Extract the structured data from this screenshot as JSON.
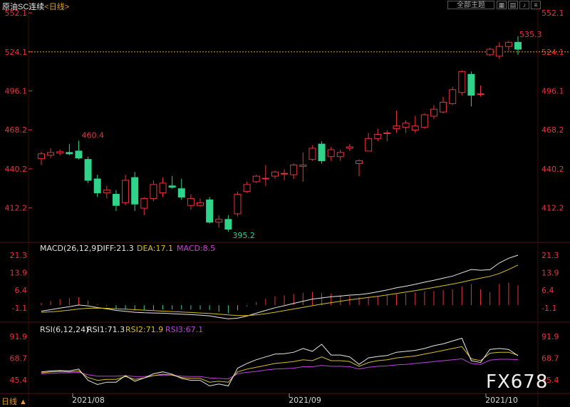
{
  "header": {
    "instrument": "原油SC连续",
    "period_label": "<日线>",
    "main_indicator_button": "全部主题",
    "toolbar_icons": [
      "grid-icon",
      "layout-icon",
      "bell-icon",
      "menu-icon"
    ]
  },
  "price_panel": {
    "ticks": [
      "552.1",
      "524.1",
      "496.1",
      "468.2",
      "440.2",
      "412.2"
    ],
    "high_label": "460.4",
    "low_label": "395.2",
    "last_high_label": "535.3",
    "current_price_line": "524.1"
  },
  "macd_panel": {
    "label": "MACD(26,12,9)",
    "diff_label": "DIFF:21.3",
    "dea_label": "DEA:17.1",
    "macd_label": "MACD:8.5",
    "ticks": [
      "21.3",
      "13.9",
      "6.4",
      "-1.1"
    ]
  },
  "rsi_panel": {
    "label": "RSI(6,12,24)",
    "rsi1_label": "RSI1:71.3",
    "rsi2_label": "RSI2:71.9",
    "rsi3_label": "RSI3:67.1",
    "ticks": [
      "91.9",
      "68.7",
      "45.4"
    ]
  },
  "x_axis": {
    "bottom_left_label": "日线 ▲",
    "month_labels": [
      "2021/08",
      "2021/09",
      "2021/10"
    ]
  },
  "watermark": "FX678",
  "colors": {
    "up": "#e8333a",
    "down": "#2fd38a",
    "diff": "#e6e6e6",
    "dea": "#d8c020",
    "macd_label": "#d040d0",
    "rsi3": "#c040e0",
    "axis_red": "#e8333a"
  },
  "chart_data": [
    {
      "type": "candlestick",
      "title": "原油SC连续 <日线>",
      "ylim": [
        395.2,
        552.1
      ],
      "ohlc": [
        [
          447.5,
          452.5,
          443.0,
          451.0
        ],
        [
          450.0,
          455.0,
          448.0,
          452.0
        ],
        [
          451.5,
          454.0,
          450.0,
          452.5
        ],
        [
          452.0,
          458.0,
          450.0,
          451.0
        ],
        [
          453.0,
          460.4,
          447.0,
          448.0
        ],
        [
          447.0,
          449.0,
          430.0,
          432.0
        ],
        [
          433.0,
          436.0,
          420.0,
          423.0
        ],
        [
          423.0,
          428.0,
          419.0,
          425.0
        ],
        [
          422.0,
          425.0,
          410.0,
          414.0
        ],
        [
          416.0,
          436.0,
          414.0,
          432.0
        ],
        [
          434.0,
          438.0,
          410.0,
          415.0
        ],
        [
          412.0,
          420.0,
          407.0,
          419.0
        ],
        [
          419.0,
          432.0,
          417.0,
          429.0
        ],
        [
          423.0,
          434.0,
          420.0,
          430.0
        ],
        [
          428.0,
          435.0,
          426.0,
          427.0
        ],
        [
          426.0,
          433.0,
          418.0,
          420.0
        ],
        [
          414.0,
          422.0,
          411.0,
          419.0
        ],
        [
          414.0,
          419.0,
          413.0,
          416.0
        ],
        [
          418.0,
          420.0,
          401.0,
          402.0
        ],
        [
          402.0,
          407.0,
          398.0,
          404.0
        ],
        [
          404.0,
          407.0,
          395.2,
          397.0
        ],
        [
          408.0,
          424.0,
          406.0,
          422.0
        ],
        [
          424.0,
          431.0,
          423.0,
          429.0
        ],
        [
          431.0,
          436.0,
          430.0,
          435.0
        ],
        [
          433.0,
          443.0,
          428.0,
          433.5
        ],
        [
          435.0,
          439.0,
          433.0,
          438.0
        ],
        [
          437.0,
          440.0,
          432.0,
          437.0
        ],
        [
          436.0,
          444.0,
          433.0,
          443.0
        ],
        [
          442.0,
          452.0,
          431.0,
          443.0
        ],
        [
          447.0,
          457.0,
          446.0,
          455.0
        ],
        [
          458.0,
          460.0,
          444.0,
          446.0
        ],
        [
          449.0,
          456.0,
          446.0,
          454.0
        ],
        [
          449.0,
          454.0,
          446.0,
          452.0
        ],
        [
          455.0,
          458.0,
          453.0,
          456.0
        ],
        [
          444.0,
          447.0,
          435.0,
          446.0
        ],
        [
          453.0,
          466.0,
          453.0,
          462.0
        ],
        [
          462.0,
          469.0,
          460.0,
          465.0
        ],
        [
          466.0,
          468.0,
          460.0,
          466.0
        ],
        [
          469.0,
          482.0,
          466.0,
          471.0
        ],
        [
          470.0,
          475.0,
          466.0,
          473.0
        ],
        [
          468.0,
          478.0,
          466.0,
          471.0
        ],
        [
          470.0,
          480.0,
          469.0,
          479.0
        ],
        [
          478.0,
          486.0,
          476.0,
          483.0
        ],
        [
          481.0,
          492.0,
          480.0,
          488.0
        ],
        [
          487.0,
          499.0,
          486.0,
          497.0
        ],
        [
          495.0,
          511.0,
          493.0,
          510.0
        ],
        [
          508.0,
          510.0,
          485.0,
          493.0
        ],
        [
          494.0,
          500.0,
          492.0,
          494.0
        ],
        [
          522.0,
          527.0,
          521.0,
          526.0
        ],
        [
          521.0,
          531.0,
          519.0,
          528.0
        ],
        [
          528.0,
          532.0,
          525.0,
          531.0
        ],
        [
          531.0,
          535.3,
          522.0,
          526.0
        ]
      ]
    },
    {
      "type": "line",
      "title": "MACD(26,12,9)",
      "ylim": [
        -6.0,
        21.3
      ],
      "series": [
        {
          "name": "DIFF",
          "values": [
            -2.5,
            -1.9,
            -1.2,
            -0.6,
            0.1,
            -0.3,
            -1.0,
            -1.5,
            -2.2,
            -2.6,
            -3.0,
            -3.2,
            -3.3,
            -3.4,
            -3.6,
            -3.8,
            -4.0,
            -4.2,
            -4.5,
            -5.2,
            -5.8,
            -5.5,
            -4.6,
            -3.4,
            -2.2,
            -1.1,
            -0.2,
            0.8,
            1.7,
            2.6,
            3.1,
            3.6,
            3.9,
            4.3,
            4.5,
            5.0,
            5.7,
            6.5,
            7.4,
            8.1,
            8.9,
            9.8,
            10.6,
            11.5,
            12.4,
            13.8,
            15.2,
            14.9,
            15.1,
            18.0,
            20.0,
            21.3
          ]
        },
        {
          "name": "DEA",
          "values": [
            -3.0,
            -2.8,
            -2.5,
            -2.1,
            -1.6,
            -1.3,
            -1.2,
            -1.3,
            -1.5,
            -1.7,
            -1.9,
            -2.1,
            -2.3,
            -2.5,
            -2.7,
            -2.9,
            -3.1,
            -3.3,
            -3.5,
            -3.8,
            -4.1,
            -4.4,
            -4.4,
            -4.1,
            -3.6,
            -3.0,
            -2.3,
            -1.6,
            -0.9,
            -0.2,
            0.5,
            1.1,
            1.7,
            2.3,
            2.8,
            3.3,
            3.8,
            4.4,
            5.0,
            5.6,
            6.2,
            6.9,
            7.6,
            8.3,
            9.0,
            9.8,
            10.7,
            11.5,
            12.3,
            13.5,
            15.2,
            17.1
          ]
        },
        {
          "name": "MACD",
          "type": "bar",
          "values": [
            1.0,
            1.8,
            2.6,
            3.0,
            3.4,
            2.0,
            0.4,
            -0.4,
            -1.4,
            -1.8,
            -2.2,
            -2.2,
            -2.0,
            -1.8,
            -1.8,
            -1.8,
            -1.8,
            -1.8,
            -2.0,
            -2.8,
            -3.4,
            -2.2,
            -0.4,
            1.4,
            2.8,
            3.8,
            4.2,
            4.8,
            5.2,
            5.6,
            5.2,
            5.0,
            4.4,
            4.0,
            3.4,
            3.4,
            3.8,
            4.2,
            4.8,
            5.0,
            5.4,
            5.8,
            6.0,
            6.4,
            6.8,
            8.0,
            9.0,
            6.8,
            5.6,
            9.0,
            9.6,
            8.5
          ]
        }
      ]
    },
    {
      "type": "line",
      "title": "RSI(6,12,24)",
      "ylim": [
        34.0,
        91.9
      ],
      "series": [
        {
          "name": "RSI1",
          "values": [
            54.0,
            55.0,
            55.5,
            55.0,
            57.0,
            45.0,
            40.5,
            43.0,
            43.0,
            50.0,
            44.0,
            47.5,
            52.0,
            54.0,
            51.5,
            47.0,
            45.0,
            45.0,
            39.0,
            41.0,
            39.0,
            58.0,
            63.0,
            67.0,
            70.0,
            73.0,
            73.5,
            75.0,
            79.0,
            76.0,
            83.5,
            72.0,
            72.0,
            70.0,
            62.0,
            69.0,
            70.5,
            71.5,
            75.0,
            76.0,
            77.0,
            79.0,
            82.0,
            84.0,
            87.0,
            90.0,
            66.0,
            64.0,
            78.0,
            79.0,
            78.0,
            71.3
          ]
        },
        {
          "name": "RSI2",
          "values": [
            53.0,
            54.0,
            54.5,
            54.0,
            55.0,
            48.0,
            45.0,
            46.0,
            46.0,
            49.0,
            46.0,
            47.5,
            50.0,
            51.5,
            50.5,
            48.0,
            47.0,
            47.0,
            43.0,
            44.0,
            43.0,
            54.0,
            57.0,
            59.0,
            61.0,
            63.0,
            64.0,
            65.0,
            67.0,
            66.0,
            70.0,
            66.0,
            66.0,
            65.0,
            60.0,
            64.0,
            66.0,
            67.0,
            69.0,
            70.0,
            71.0,
            73.0,
            75.0,
            77.0,
            79.0,
            81.0,
            68.0,
            66.0,
            74.0,
            75.0,
            75.0,
            71.9
          ]
        },
        {
          "name": "RSI3",
          "values": [
            52.0,
            52.5,
            53.0,
            53.0,
            53.5,
            51.0,
            49.5,
            49.5,
            49.5,
            50.0,
            49.0,
            49.0,
            50.0,
            50.5,
            50.5,
            49.5,
            49.0,
            49.0,
            47.5,
            47.0,
            46.5,
            52.0,
            53.5,
            54.5,
            56.0,
            57.0,
            57.5,
            58.0,
            59.5,
            59.5,
            61.0,
            60.0,
            60.0,
            59.5,
            57.0,
            59.0,
            60.0,
            60.5,
            61.5,
            62.0,
            63.0,
            64.0,
            65.0,
            66.0,
            67.0,
            68.0,
            63.0,
            62.0,
            66.5,
            67.5,
            67.5,
            67.1
          ]
        }
      ]
    }
  ]
}
